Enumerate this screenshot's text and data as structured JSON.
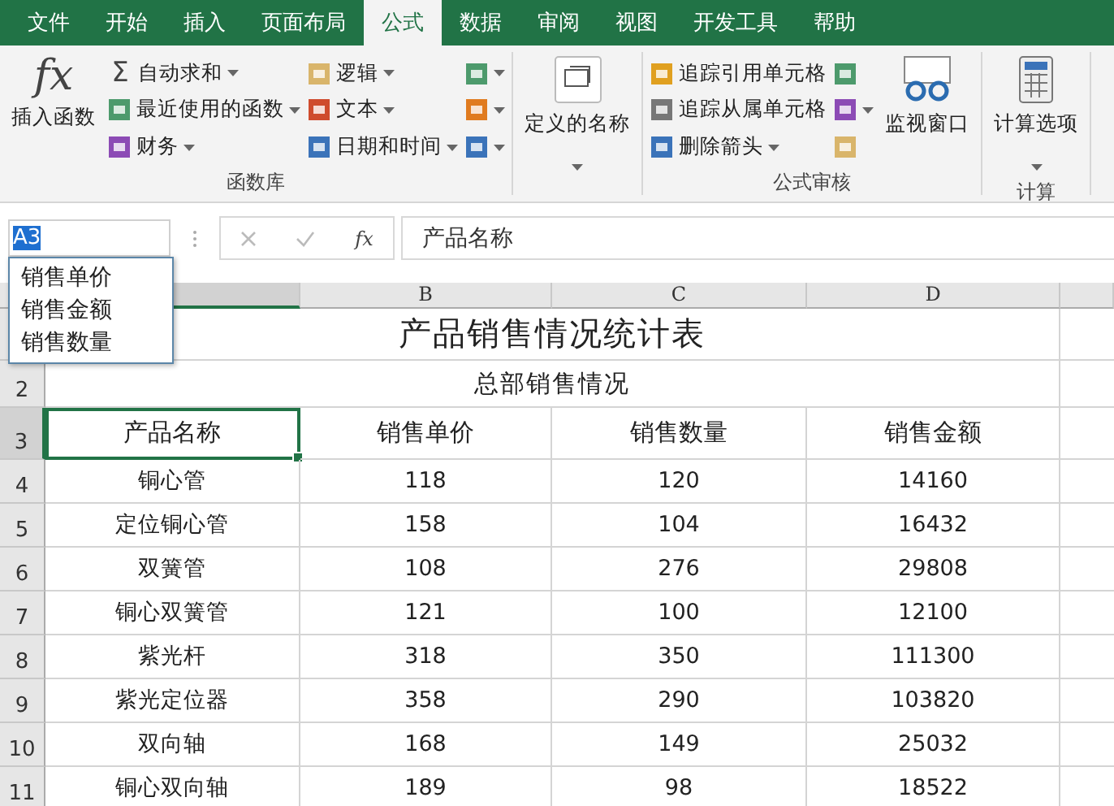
{
  "tabs": [
    {
      "label": "文件",
      "selected": false
    },
    {
      "label": "开始",
      "selected": false
    },
    {
      "label": "插入",
      "selected": false
    },
    {
      "label": "页面布局",
      "selected": false
    },
    {
      "label": "公式",
      "selected": true
    },
    {
      "label": "数据",
      "selected": false
    },
    {
      "label": "审阅",
      "selected": false
    },
    {
      "label": "视图",
      "selected": false
    },
    {
      "label": "开发工具",
      "selected": false
    },
    {
      "label": "帮助",
      "selected": false
    }
  ],
  "ribbon": {
    "groups": [
      {
        "label": "函数库",
        "sections": [
          {
            "kind": "large",
            "label": "插入函数",
            "glyph": "fx",
            "dropdown": false
          },
          {
            "kind": "stack",
            "items": [
              {
                "label": "自动求和",
                "glyph": "Σ",
                "dropdown": true
              },
              {
                "label": "最近使用的函数",
                "dropdown": true
              },
              {
                "label": "财务",
                "dropdown": true
              }
            ]
          },
          {
            "kind": "stack",
            "items": [
              {
                "label": "逻辑",
                "dropdown": true
              },
              {
                "label": "文本",
                "dropdown": true
              },
              {
                "label": "日期和时间",
                "dropdown": true
              }
            ]
          },
          {
            "kind": "stack",
            "items": [
              {
                "dropdown": true
              },
              {
                "dropdown": true
              },
              {
                "dropdown": true
              }
            ]
          }
        ]
      },
      {
        "sections": [
          {
            "kind": "large",
            "label": "定义的名称",
            "dropdown": true
          }
        ]
      },
      {
        "label": "公式审核",
        "sections": [
          {
            "kind": "stack",
            "items": [
              {
                "label": "追踪引用单元格",
                "dropdown": false
              },
              {
                "label": "追踪从属单元格",
                "dropdown": false
              },
              {
                "label": "删除箭头",
                "dropdown": true
              }
            ]
          },
          {
            "kind": "stack",
            "items": [
              {
                "dropdown": false
              },
              {
                "dropdown": true
              },
              {
                "dropdown": false
              }
            ]
          },
          {
            "kind": "large",
            "label": "监视窗口",
            "dropdown": false
          }
        ]
      },
      {
        "label": "计算",
        "sections": [
          {
            "kind": "large",
            "label": "计算选项",
            "dropdown": true
          }
        ]
      }
    ]
  },
  "formula_bar": {
    "name_box": "A3",
    "glyph": "fx",
    "value": "产品名称"
  },
  "autocomplete": [
    "销售单价",
    "销售金额",
    "销售数量"
  ],
  "sheet": {
    "columns": [
      "B",
      "C",
      "D"
    ],
    "rows": [
      {
        "kind": "merged",
        "text": "产品销售情况统计表"
      },
      {
        "kind": "merged",
        "number": "2",
        "text": "总部销售情况"
      },
      {
        "kind": "cells",
        "number": "3",
        "cells": [
          {
            "text": "产品名称",
            "selected": true
          },
          {
            "text": "销售单价",
            "selected": false
          },
          {
            "text": "销售数量",
            "selected": false
          },
          {
            "text": "销售金额",
            "selected": false
          }
        ]
      },
      {
        "kind": "cells",
        "number": "4",
        "cells": [
          {
            "text": "铜心管",
            "selected": false
          },
          {
            "text": "118",
            "selected": false
          },
          {
            "text": "120",
            "selected": false
          },
          {
            "text": "14160",
            "selected": false
          }
        ]
      },
      {
        "kind": "cells",
        "number": "5",
        "cells": [
          {
            "text": "定位铜心管",
            "selected": false
          },
          {
            "text": "158",
            "selected": false
          },
          {
            "text": "104",
            "selected": false
          },
          {
            "text": "16432",
            "selected": false
          }
        ]
      },
      {
        "kind": "cells",
        "number": "6",
        "cells": [
          {
            "text": "双簧管",
            "selected": false
          },
          {
            "text": "108",
            "selected": false
          },
          {
            "text": "276",
            "selected": false
          },
          {
            "text": "29808",
            "selected": false
          }
        ]
      },
      {
        "kind": "cells",
        "number": "7",
        "cells": [
          {
            "text": "铜心双簧管",
            "selected": false
          },
          {
            "text": "121",
            "selected": false
          },
          {
            "text": "100",
            "selected": false
          },
          {
            "text": "12100",
            "selected": false
          }
        ]
      },
      {
        "kind": "cells",
        "number": "8",
        "cells": [
          {
            "text": "紫光杆",
            "selected": false
          },
          {
            "text": "318",
            "selected": false
          },
          {
            "text": "350",
            "selected": false
          },
          {
            "text": "111300",
            "selected": false
          }
        ]
      },
      {
        "kind": "cells",
        "number": "9",
        "cells": [
          {
            "text": "紫光定位器",
            "selected": false
          },
          {
            "text": "358",
            "selected": false
          },
          {
            "text": "290",
            "selected": false
          },
          {
            "text": "103820",
            "selected": false
          }
        ]
      },
      {
        "kind": "cells",
        "number": "10",
        "cells": [
          {
            "text": "双向轴",
            "selected": false
          },
          {
            "text": "168",
            "selected": false
          },
          {
            "text": "149",
            "selected": false
          },
          {
            "text": "25032",
            "selected": false
          }
        ]
      },
      {
        "kind": "cells",
        "number": "11",
        "cells": [
          {
            "text": "铜心双向轴",
            "selected": false
          },
          {
            "text": "189",
            "selected": false
          },
          {
            "text": "98",
            "selected": false
          },
          {
            "text": "18522",
            "selected": false
          }
        ]
      }
    ]
  }
}
